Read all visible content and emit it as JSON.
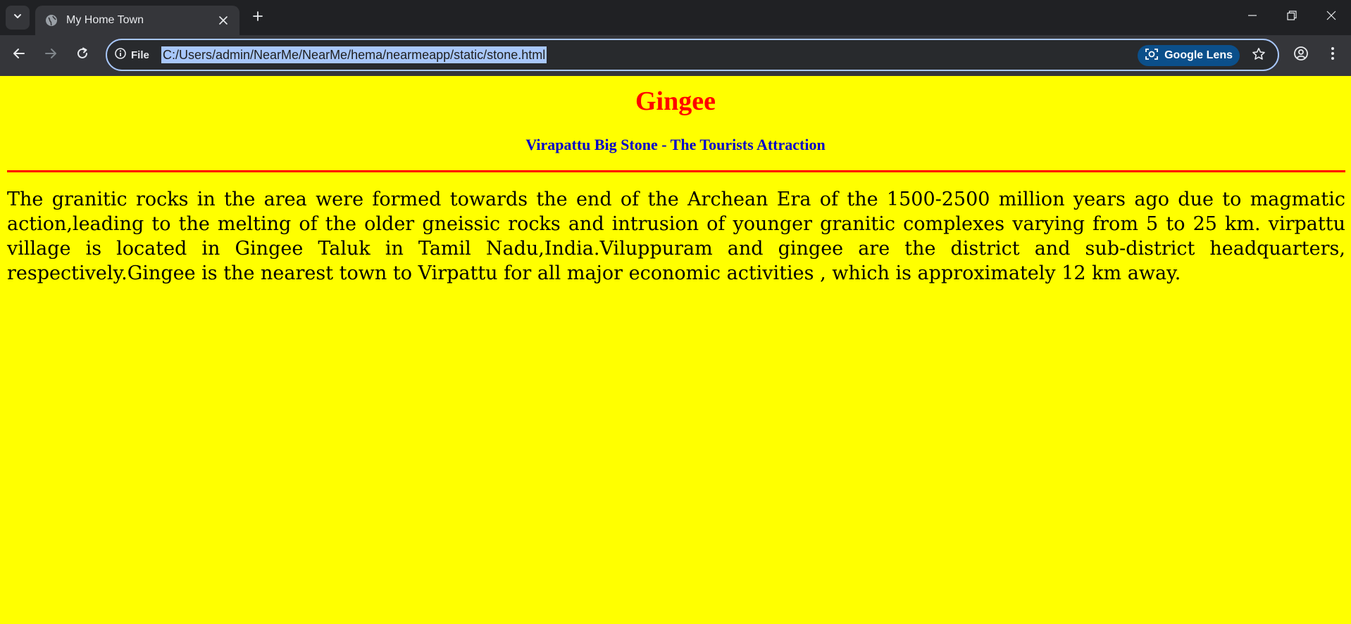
{
  "browser": {
    "tab": {
      "title": "My Home Town"
    },
    "omnibox": {
      "site_info_label": "File",
      "url": "C:/Users/admin/NearMe/NearMe/hema/nearmeapp/static/stone.html",
      "lens_label": "Google Lens"
    },
    "colors": {
      "frame": "#202124",
      "toolbar": "#35363a",
      "url_highlight": "#a8c7fa"
    }
  },
  "page": {
    "heading": "Gingee",
    "subheading": "Virapattu Big Stone - The Tourists Attraction",
    "paragraph": "The granitic rocks in the area were formed towards the end of the Archean Era of the 1500-2500 million years ago due to magmatic action,leading to the melting of the older gneissic rocks and intrusion of younger granitic complexes varying from 5 to 25 km. virpattu village is located in Gingee Taluk in Tamil Nadu,India.Viluppuram and gingee are the district and sub-district headquarters, respectively.Gingee is the nearest town to Virpattu for all major economic activities , which is approximately 12 km away.",
    "colors": {
      "background": "#ffff00",
      "heading": "#ff0000",
      "subheading": "#0000cc",
      "divider": "#ff0000",
      "text": "#000000"
    }
  }
}
